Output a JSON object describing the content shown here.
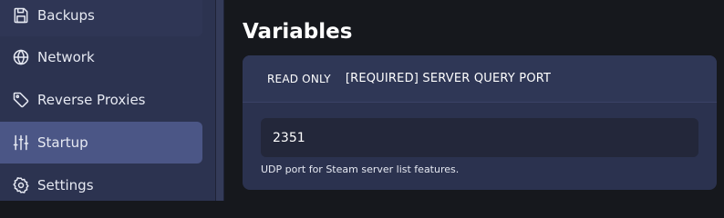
{
  "sidebar": {
    "items": [
      {
        "label": "Backups",
        "icon": "save-icon"
      },
      {
        "label": "Network",
        "icon": "globe-icon"
      },
      {
        "label": "Reverse Proxies",
        "icon": "tag-icon"
      },
      {
        "label": "Startup",
        "icon": "sliders-icon",
        "active": true
      },
      {
        "label": "Settings",
        "icon": "gear-icon"
      }
    ]
  },
  "main": {
    "heading": "Variables",
    "variable": {
      "readonly_label": "READ ONLY",
      "name": "[REQUIRED] SERVER QUERY PORT",
      "value": "2351",
      "description": "UDP port for Steam server list features."
    }
  },
  "colors": {
    "sidebar_bg": "#2c3350",
    "active_item_bg": "#4b5686",
    "page_bg": "#16181d",
    "card_bg": "#2b324f",
    "input_bg": "#23273a"
  }
}
